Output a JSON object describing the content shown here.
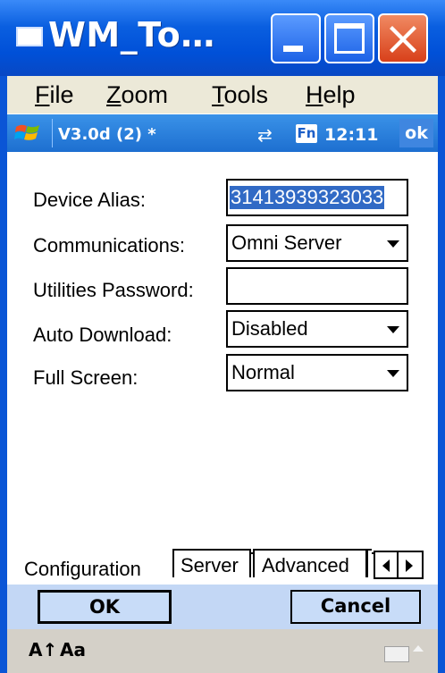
{
  "window": {
    "title": "WM_To…",
    "minimize_icon": "minimize-icon",
    "maximize_icon": "maximize-icon",
    "close_icon": "close-icon",
    "close_glyph": "✕"
  },
  "menu": {
    "items": [
      {
        "label_ul": "F",
        "label_rest": "ile"
      },
      {
        "label_ul": "Z",
        "label_rest": "oom"
      },
      {
        "label_ul": "T",
        "label_rest": "ools"
      },
      {
        "label_ul": "H",
        "label_rest": "elp"
      }
    ]
  },
  "status": {
    "start_icon": "windows-flag-icon",
    "version": "V3.0d (2)  *",
    "sync_glyph": "⇄",
    "fn_label": "Fn",
    "time": "12:11",
    "ok": "ok"
  },
  "form": {
    "device_alias": {
      "label": "Device Alias:",
      "value": "31413939323033"
    },
    "communications": {
      "label": "Communications:",
      "value": "Omni Server"
    },
    "utilities_password": {
      "label": "Utilities Password:",
      "value": ""
    },
    "auto_download": {
      "label": "Auto Download:",
      "value": "Disabled"
    },
    "full_screen": {
      "label": "Full Screen:",
      "value": "Normal"
    }
  },
  "tabs": {
    "items": [
      "Configuration",
      "Server",
      "Advanced"
    ],
    "active": "Configuration"
  },
  "commands": {
    "ok": "OK",
    "cancel": "Cancel"
  },
  "input_panel": {
    "font_up": "A↑",
    "font": "Aa"
  },
  "colors": {
    "title_bar": "#0050d8",
    "status_bar": "#1d6fd0",
    "selection": "#316ac5",
    "command_bar": "#c3d7f5"
  }
}
